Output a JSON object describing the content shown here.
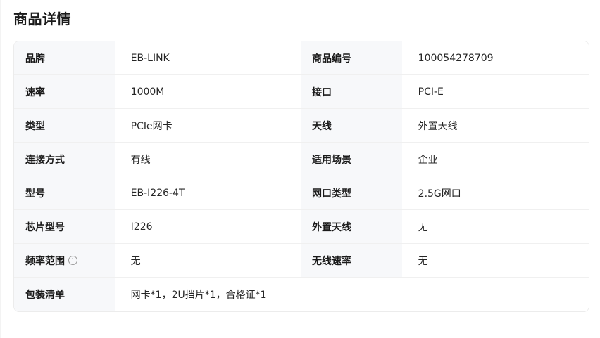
{
  "section_title": "商品详情",
  "rows": [
    {
      "label1": "品牌",
      "value1": "EB-LINK",
      "label2": "商品编号",
      "value2": "100054278709"
    },
    {
      "label1": "速率",
      "value1": "1000M",
      "label2": "接口",
      "value2": "PCI-E"
    },
    {
      "label1": "类型",
      "value1": "PCIe网卡",
      "label2": "天线",
      "value2": "外置天线"
    },
    {
      "label1": "连接方式",
      "value1": "有线",
      "label2": "适用场景",
      "value2": "企业"
    },
    {
      "label1": "型号",
      "value1": "EB-I226-4T",
      "label2": "网口类型",
      "value2": "2.5G网口"
    },
    {
      "label1": "芯片型号",
      "value1": "I226",
      "label2": "外置天线",
      "value2": "无"
    },
    {
      "label1": "频率范围",
      "value1": "无",
      "label2": "无线速率",
      "value2": "无",
      "label1_icon": "info-icon"
    },
    {
      "label1": "包装清单",
      "value1": "网卡*1，2U挡片*1，合格证*1"
    }
  ]
}
